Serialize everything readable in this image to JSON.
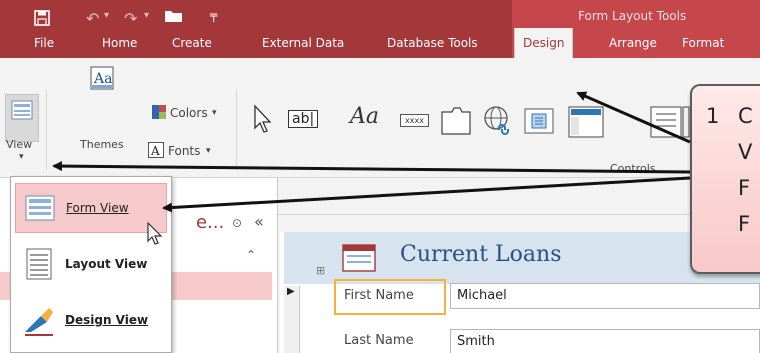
{
  "titlebar": {
    "contextual_title": "Form Layout Tools",
    "accent": "#a4373a"
  },
  "tabs": [
    {
      "label": "File"
    },
    {
      "label": "Home"
    },
    {
      "label": "Create"
    },
    {
      "label": "External Data"
    },
    {
      "label": "Database Tools"
    },
    {
      "label": "Design"
    },
    {
      "label": "Arrange"
    },
    {
      "label": "Format"
    }
  ],
  "ribbon": {
    "view_label": "View",
    "themes_label": "Themes",
    "colors_label": "Colors",
    "fonts_label": "Fonts",
    "controls_group_label": "Controls",
    "textbox_glyph": "ab|",
    "label_glyph": "Aa",
    "button_glyph": "xxxx"
  },
  "nav": {
    "title_partial": "e...",
    "collapse_glyph": "«"
  },
  "view_menu": {
    "items": [
      {
        "label": "Form View",
        "icon": "form-view-icon"
      },
      {
        "label": "Layout View",
        "icon": "layout-view-icon"
      },
      {
        "label": "Design View",
        "icon": "design-view-icon"
      }
    ]
  },
  "form": {
    "title": "Current Loans",
    "fields": [
      {
        "label": "First Name",
        "value": "Michael"
      },
      {
        "label": "Last Name",
        "value": "Smith"
      }
    ]
  },
  "callout": {
    "number": "1",
    "lines": [
      "C",
      "V",
      "F",
      "F"
    ]
  }
}
